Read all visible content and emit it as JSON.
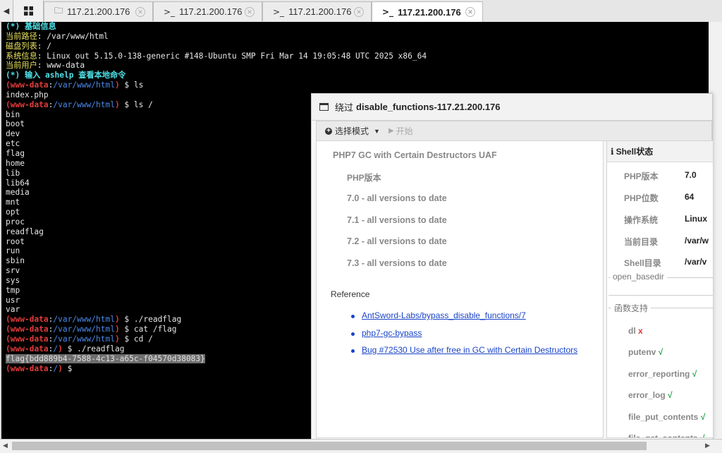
{
  "tabs": [
    {
      "icon": "folder-icon",
      "label": "117.21.200.176",
      "active": false
    },
    {
      "icon": "terminal-icon",
      "label": "117.21.200.176",
      "active": false
    },
    {
      "icon": "terminal-icon",
      "label": "117.21.200.176",
      "active": false
    },
    {
      "icon": "terminal-icon",
      "label": "117.21.200.176",
      "active": true
    }
  ],
  "tab_icons": {
    "folder": "🗀",
    "terminal": ">_",
    "close": "✕",
    "scroll_left": "◀"
  },
  "terminal": {
    "lines": [
      [
        {
          "c": "cyan",
          "t": "(*) 基础信息"
        }
      ],
      [
        {
          "c": "yellow",
          "t": "当前路径"
        },
        {
          "c": "white",
          "t": ": /var/www/html"
        }
      ],
      [
        {
          "c": "yellow",
          "t": "磁盘列表"
        },
        {
          "c": "white",
          "t": ": /"
        }
      ],
      [
        {
          "c": "yellow",
          "t": "系统信息"
        },
        {
          "c": "white",
          "t": ": Linux out 5.15.0-138-generic #148-Ubuntu SMP Fri Mar 14 19:05:48 UTC 2025 x86_64"
        }
      ],
      [
        {
          "c": "yellow",
          "t": "当前用户"
        },
        {
          "c": "white",
          "t": ": www-data"
        }
      ],
      [
        {
          "c": "cyan",
          "t": "(*) 输入 ashelp 查看本地命令"
        }
      ],
      [
        {
          "c": "red",
          "t": "(www-data"
        },
        {
          "c": "white",
          "t": ":"
        },
        {
          "c": "blue",
          "t": "/var/www/html"
        },
        {
          "c": "red",
          "t": ")"
        },
        {
          "c": "white",
          "t": " $ ls"
        }
      ],
      [
        {
          "c": "white",
          "t": "index.php"
        }
      ],
      [
        {
          "c": "red",
          "t": "(www-data"
        },
        {
          "c": "white",
          "t": ":"
        },
        {
          "c": "blue",
          "t": "/var/www/html"
        },
        {
          "c": "red",
          "t": ")"
        },
        {
          "c": "white",
          "t": " $ ls /"
        }
      ],
      [
        {
          "c": "white",
          "t": "bin"
        }
      ],
      [
        {
          "c": "white",
          "t": "boot"
        }
      ],
      [
        {
          "c": "white",
          "t": "dev"
        }
      ],
      [
        {
          "c": "white",
          "t": "etc"
        }
      ],
      [
        {
          "c": "white",
          "t": "flag"
        }
      ],
      [
        {
          "c": "white",
          "t": "home"
        }
      ],
      [
        {
          "c": "white",
          "t": "lib"
        }
      ],
      [
        {
          "c": "white",
          "t": "lib64"
        }
      ],
      [
        {
          "c": "white",
          "t": "media"
        }
      ],
      [
        {
          "c": "white",
          "t": "mnt"
        }
      ],
      [
        {
          "c": "white",
          "t": "opt"
        }
      ],
      [
        {
          "c": "white",
          "t": "proc"
        }
      ],
      [
        {
          "c": "white",
          "t": "readflag"
        }
      ],
      [
        {
          "c": "white",
          "t": "root"
        }
      ],
      [
        {
          "c": "white",
          "t": "run"
        }
      ],
      [
        {
          "c": "white",
          "t": "sbin"
        }
      ],
      [
        {
          "c": "white",
          "t": "srv"
        }
      ],
      [
        {
          "c": "white",
          "t": "sys"
        }
      ],
      [
        {
          "c": "white",
          "t": "tmp"
        }
      ],
      [
        {
          "c": "white",
          "t": "usr"
        }
      ],
      [
        {
          "c": "white",
          "t": "var"
        }
      ],
      [
        {
          "c": "red",
          "t": "(www-data"
        },
        {
          "c": "white",
          "t": ":"
        },
        {
          "c": "blue",
          "t": "/var/www/html"
        },
        {
          "c": "red",
          "t": ")"
        },
        {
          "c": "white",
          "t": " $ ./readflag"
        }
      ],
      [
        {
          "c": "red",
          "t": "(www-data"
        },
        {
          "c": "white",
          "t": ":"
        },
        {
          "c": "blue",
          "t": "/var/www/html"
        },
        {
          "c": "red",
          "t": ")"
        },
        {
          "c": "white",
          "t": " $ cat /flag"
        }
      ],
      [
        {
          "c": "red",
          "t": "(www-data"
        },
        {
          "c": "white",
          "t": ":"
        },
        {
          "c": "blue",
          "t": "/var/www/html"
        },
        {
          "c": "red",
          "t": ")"
        },
        {
          "c": "white",
          "t": " $ cd /"
        }
      ],
      [
        {
          "c": "red",
          "t": "(www-data"
        },
        {
          "c": "white",
          "t": ":"
        },
        {
          "c": "blue",
          "t": "/"
        },
        {
          "c": "red",
          "t": ")"
        },
        {
          "c": "white",
          "t": " $ ./readflag"
        }
      ],
      [
        {
          "c": "hl",
          "t": "flag{bdd889b4-7588-4c13-a65c-f04570d38083}"
        }
      ],
      [
        {
          "c": "red",
          "t": "(www-data"
        },
        {
          "c": "white",
          "t": ":"
        },
        {
          "c": "blue",
          "t": "/"
        },
        {
          "c": "red",
          "t": ")"
        },
        {
          "c": "white",
          "t": " $ "
        }
      ]
    ]
  },
  "panel": {
    "title_prefix": "绕过",
    "title_bold": "disable_functions-117.21.200.176",
    "toolbar": {
      "mode_label": "选择模式",
      "start_label": "开始",
      "plus": "+",
      "caret": "▼",
      "play": "▶"
    },
    "left": {
      "exploit_title": "PHP7 GC with Certain Destructors UAF",
      "php_version_heading": "PHP版本",
      "versions": [
        "7.0 - all versions to date",
        "7.1 - all versions to date",
        "7.2 - all versions to date",
        "7.3 - all versions to date"
      ],
      "reference_heading": "Reference",
      "references": [
        "AntSword-Labs/bypass_disable_functions/7",
        "php7-gc-bypass",
        "Bug #72530 Use after free in GC with Certain Destructors"
      ]
    },
    "right": {
      "header": "Shell状态",
      "info_glyph": "i",
      "status": [
        {
          "key": "PHP版本",
          "value": "7.0"
        },
        {
          "key": "PHP位数",
          "value": "64"
        },
        {
          "key": "操作系统",
          "value": "Linux"
        },
        {
          "key": "当前目录",
          "value": "/var/w"
        },
        {
          "key": "Shell目录",
          "value": "/var/v"
        }
      ],
      "open_basedir_label": "open_basedir",
      "functions_label": "函数支持",
      "functions": [
        {
          "name": "dl",
          "supported": false
        },
        {
          "name": "putenv",
          "supported": true
        },
        {
          "name": "error_reporting",
          "supported": true
        },
        {
          "name": "error_log",
          "supported": true
        },
        {
          "name": "file_put_contents",
          "supported": true
        },
        {
          "name": "file_get_contents",
          "supported": true
        }
      ],
      "check_glyph": "√",
      "cross_glyph": "x"
    }
  },
  "colors": {
    "terminal_bg": "#000000",
    "prompt_user": "#e23b3b",
    "prompt_path": "#4b88e8",
    "info_heading": "#4fe0e6",
    "info_key": "#e8e35c",
    "link": "#1a44c8",
    "ok": "#27a34a"
  }
}
